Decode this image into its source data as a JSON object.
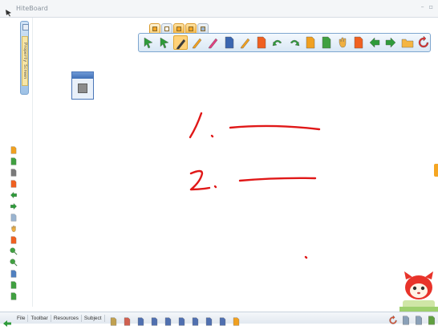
{
  "window": {
    "title": "HiteBoard",
    "minimize_label": "–",
    "restore_label": "▫",
    "close_label": ""
  },
  "properties_panel": {
    "tab_label": "Property Screen"
  },
  "top_tabs": [
    {
      "name": "home-tab-icon",
      "color": "#f5a623"
    },
    {
      "name": "page-tab-icon",
      "color": "#ffffff"
    },
    {
      "name": "pencil-tab-icon",
      "color": "#f5a623"
    },
    {
      "name": "ruler-tab-icon",
      "color": "#f5a623"
    },
    {
      "name": "gallery-tab-icon",
      "color": "#9ab4d0"
    }
  ],
  "main_toolbar": {
    "tools": [
      {
        "name": "select-arrow-icon",
        "color": "#2e9b3a",
        "selected": false
      },
      {
        "name": "multi-select-icon",
        "color": "#2e9b3a",
        "selected": false
      },
      {
        "name": "pen-icon",
        "color": "#3a3a3a",
        "selected": true
      },
      {
        "name": "brush-icon",
        "color": "#f0a020",
        "selected": false
      },
      {
        "name": "highlighter-icon",
        "color": "#e04080",
        "selected": false
      },
      {
        "name": "line-style-icon",
        "color": "#3a66b0",
        "selected": false
      },
      {
        "name": "magic-pen-icon",
        "color": "#f0a020",
        "selected": false
      },
      {
        "name": "eraser-page-icon",
        "color": "#f06020",
        "selected": false
      },
      {
        "name": "undo-icon",
        "color": "#2e9b3a",
        "selected": false
      },
      {
        "name": "redo-icon",
        "color": "#2e9b3a",
        "selected": false
      },
      {
        "name": "edit-page-icon",
        "color": "#f0a020",
        "selected": false
      },
      {
        "name": "new-page-icon",
        "color": "#40a040",
        "selected": false
      },
      {
        "name": "hand-pan-icon",
        "color": "#f0b040",
        "selected": false
      },
      {
        "name": "delete-page-icon",
        "color": "#f06020",
        "selected": false
      },
      {
        "name": "prev-page-icon",
        "color": "#2e9b3a",
        "selected": false
      },
      {
        "name": "next-page-icon",
        "color": "#2e9b3a",
        "selected": false
      },
      {
        "name": "folder-icon",
        "color": "#f5b540",
        "selected": false
      },
      {
        "name": "refresh-icon",
        "color": "#e03030",
        "selected": false
      }
    ]
  },
  "left_toolbar": [
    {
      "name": "edit-icon",
      "color": "#f0a020"
    },
    {
      "name": "new-page-icon",
      "color": "#40a040"
    },
    {
      "name": "copy-page-icon",
      "color": "#7a7a7a"
    },
    {
      "name": "clear-page-icon",
      "color": "#f06020"
    },
    {
      "name": "prev-page-icon",
      "color": "#2e9b3a"
    },
    {
      "name": "next-page-icon",
      "color": "#2e9b3a"
    },
    {
      "name": "page-list-icon",
      "color": "#9ab4d0"
    },
    {
      "name": "hand-icon",
      "color": "#f0b040"
    },
    {
      "name": "delete-icon",
      "color": "#f06020"
    },
    {
      "name": "zoom-in-icon",
      "color": "#40a040"
    },
    {
      "name": "zoom-out-icon",
      "color": "#40a040"
    },
    {
      "name": "record-icon",
      "color": "#5080c0"
    },
    {
      "name": "screen-icon",
      "color": "#40a040"
    },
    {
      "name": "settings-icon",
      "color": "#40a040"
    }
  ],
  "bottom_bar": {
    "menus": [
      "File",
      "Toolbar",
      "Resources",
      "Subject"
    ],
    "tools": [
      {
        "name": "protractor-tool-icon",
        "color": "#c0a050"
      },
      {
        "name": "function-tool-icon",
        "color": "#d06050"
      },
      {
        "name": "graph-tool-icon",
        "color": "#5070b0"
      },
      {
        "name": "geometry-tool-icon",
        "color": "#5070b0"
      },
      {
        "name": "cube-tool-icon",
        "color": "#5070b0"
      },
      {
        "name": "triangle-tool-icon",
        "color": "#5070b0"
      },
      {
        "name": "set-square-tool-icon",
        "color": "#5070b0"
      },
      {
        "name": "compass-tool-icon",
        "color": "#5070b0"
      },
      {
        "name": "protractor-half-icon",
        "color": "#5070b0"
      },
      {
        "name": "ruler-tool-icon",
        "color": "#f0a020"
      }
    ],
    "right_icons": [
      {
        "name": "sync-icon",
        "color": "#e05030"
      },
      {
        "name": "document-icon",
        "color": "#8aa0b8"
      },
      {
        "name": "window-icon",
        "color": "#8aa0b8"
      },
      {
        "name": "desktop-icon",
        "color": "#60a040"
      }
    ]
  },
  "colors": {
    "ink": "#e01818",
    "accent": "#f5a623",
    "toolbar_border": "#7ea6cf"
  }
}
